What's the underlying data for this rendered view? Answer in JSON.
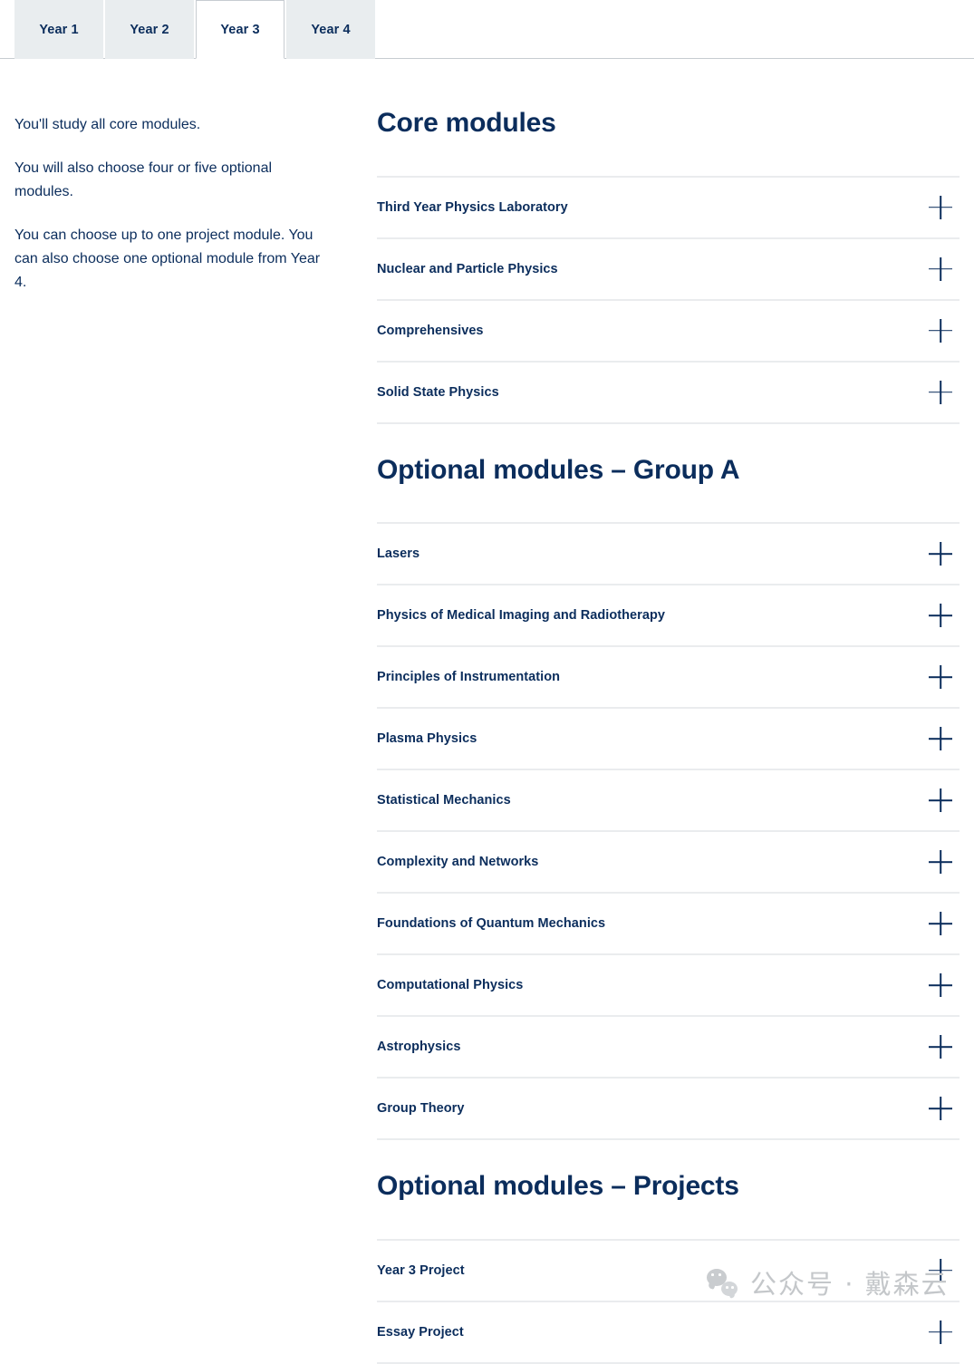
{
  "tabs": [
    {
      "label": "Year 1",
      "active": false
    },
    {
      "label": "Year 2",
      "active": false
    },
    {
      "label": "Year 3",
      "active": true
    },
    {
      "label": "Year 4",
      "active": false
    }
  ],
  "intro": {
    "paragraph_1": "You'll study all core modules.",
    "paragraph_2": "You will also choose four or five optional modules.",
    "paragraph_3": "You can choose up to one project module. You can also choose one optional module from Year 4."
  },
  "sections": [
    {
      "title": "Core modules",
      "items": [
        {
          "label": "Third Year Physics Laboratory",
          "icon": "plus-icon"
        },
        {
          "label": "Nuclear and Particle Physics",
          "icon": "plus-icon"
        },
        {
          "label": "Comprehensives",
          "icon": "plus-icon"
        },
        {
          "label": "Solid State Physics",
          "icon": "plus-icon"
        }
      ]
    },
    {
      "title": "Optional modules – Group A",
      "items": [
        {
          "label": "Lasers",
          "icon": "plus-icon"
        },
        {
          "label": "Physics of Medical Imaging and Radiotherapy",
          "icon": "plus-icon"
        },
        {
          "label": "Principles of Instrumentation",
          "icon": "plus-icon"
        },
        {
          "label": "Plasma Physics",
          "icon": "plus-icon"
        },
        {
          "label": "Statistical Mechanics",
          "icon": "plus-icon"
        },
        {
          "label": "Complexity and Networks",
          "icon": "plus-icon"
        },
        {
          "label": "Foundations of Quantum Mechanics",
          "icon": "plus-icon"
        },
        {
          "label": "Computational Physics",
          "icon": "plus-icon"
        },
        {
          "label": "Astrophysics",
          "icon": "plus-icon"
        },
        {
          "label": "Group Theory",
          "icon": "plus-icon"
        }
      ]
    },
    {
      "title": "Optional modules – Projects",
      "items": [
        {
          "label": "Year 3 Project",
          "icon": "plus-icon"
        },
        {
          "label": "Essay Project",
          "icon": "plus-icon"
        }
      ]
    }
  ],
  "watermark": {
    "text": "公众号 · 戴森云",
    "logo": "wechat-logo",
    "color": "#c4c7ca"
  },
  "theme": {
    "text_navy": "#0b2d5c",
    "tab_inactive_bg": "#e9edef",
    "tab_active_bg": "#ffffff",
    "tab_border": "#c7ccd1",
    "divider": "#eaecee",
    "page_bg": "#ffffff"
  }
}
